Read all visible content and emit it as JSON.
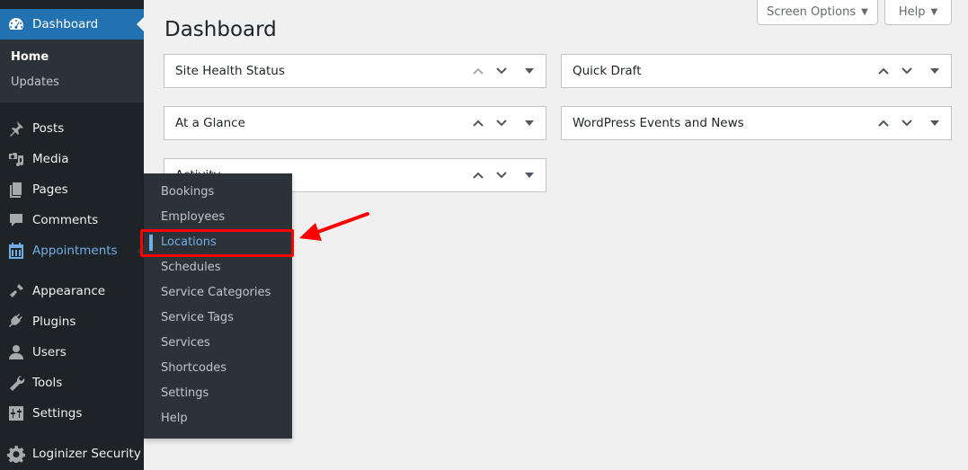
{
  "sidebar": {
    "dashboard": {
      "label": "Dashboard",
      "icon": "dashboard-icon"
    },
    "submenu": [
      {
        "label": "Home",
        "current": true
      },
      {
        "label": "Updates",
        "current": false
      }
    ],
    "items": [
      {
        "label": "Posts",
        "icon": "pin-icon"
      },
      {
        "label": "Media",
        "icon": "media-icon"
      },
      {
        "label": "Pages",
        "icon": "pages-icon"
      },
      {
        "label": "Comments",
        "icon": "comment-icon"
      },
      {
        "label": "Appointments",
        "icon": "calendar-icon"
      },
      {
        "label": "Appearance",
        "icon": "paintbrush-icon"
      },
      {
        "label": "Plugins",
        "icon": "plug-icon"
      },
      {
        "label": "Users",
        "icon": "user-icon"
      },
      {
        "label": "Tools",
        "icon": "wrench-icon"
      },
      {
        "label": "Settings",
        "icon": "settings-sliders-icon"
      },
      {
        "label": "Loginizer Security",
        "icon": "gear-icon"
      }
    ]
  },
  "flyout": {
    "parent": "Appointments",
    "items": [
      {
        "label": "Bookings"
      },
      {
        "label": "Employees"
      },
      {
        "label": "Locations",
        "current": true
      },
      {
        "label": "Schedules"
      },
      {
        "label": "Service Categories"
      },
      {
        "label": "Service Tags"
      },
      {
        "label": "Services"
      },
      {
        "label": "Shortcodes"
      },
      {
        "label": "Settings"
      },
      {
        "label": "Help"
      }
    ]
  },
  "header": {
    "title": "Dashboard",
    "screen_options_label": "Screen Options",
    "help_label": "Help",
    "caret": "▼"
  },
  "widgets": {
    "left": [
      {
        "title": "Site Health Status"
      },
      {
        "title": "At a Glance"
      },
      {
        "title": "Activity"
      }
    ],
    "right": [
      {
        "title": "Quick Draft"
      },
      {
        "title": "WordPress Events and News"
      }
    ]
  },
  "annotation": {
    "highlight_target": "Locations",
    "color": "#ff0000"
  },
  "colors": {
    "sidebar_bg": "#1d2327",
    "submenu_bg": "#2c3338",
    "accent": "#2271b1",
    "hover": "#72aee6",
    "page_bg": "#f0f0f1"
  }
}
